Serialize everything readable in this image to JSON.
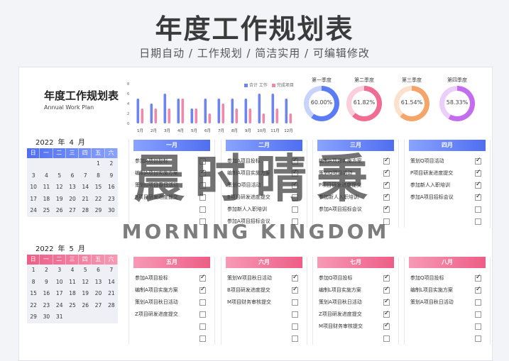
{
  "banner": {
    "title": "年度工作规划表",
    "subtitle": "日期自动 / 工作规划 / 简洁实用 / 可编辑修改"
  },
  "plan": {
    "title": "年度工作规划表",
    "subtitle": "Annual Work Plan"
  },
  "colors": {
    "blue": "#5b7cf5",
    "pink": "#f06c93",
    "orange": "#f5a46a",
    "purple": "#c46cf0"
  },
  "chart_data": {
    "type": "bar",
    "categories": [
      "1月",
      "2月",
      "3月",
      "4月",
      "5月",
      "6月",
      "7月",
      "8月",
      "9月",
      "10月",
      "11月",
      "12月"
    ],
    "series": [
      {
        "name": "合计 工作",
        "color": "#6d86ef",
        "values": [
          5,
          4,
          6,
          5,
          3,
          5,
          5,
          5,
          5,
          6,
          6,
          5
        ]
      },
      {
        "name": "完成项目",
        "color": "#f088aa",
        "values": [
          3,
          3,
          3,
          5,
          3,
          2,
          4,
          3,
          3,
          2,
          3,
          2
        ]
      }
    ],
    "ylim": [
      0,
      8
    ],
    "yticks": [
      "0",
      "2",
      "4",
      "6",
      "8"
    ]
  },
  "quarters": [
    {
      "label": "第一季度",
      "pct": "60.00%",
      "value": 0.6,
      "color": "#5b7cf5"
    },
    {
      "label": "第二季度",
      "pct": "61.82%",
      "value": 0.6182,
      "color": "#f06c93"
    },
    {
      "label": "第三季度",
      "pct": "61.54%",
      "value": 0.6154,
      "color": "#f5a46a"
    },
    {
      "label": "第四季度",
      "pct": "58.33%",
      "value": 0.5833,
      "color": "#c46cf0"
    }
  ],
  "calendars": [
    {
      "year": "2022",
      "month": "4",
      "u_year": "年",
      "u_month": "月",
      "weekdays": [
        "日",
        "一",
        "二",
        "三",
        "四",
        "五",
        "六"
      ],
      "days": [
        "",
        "",
        "",
        "",
        "",
        "1",
        "2",
        "3",
        "4",
        "5",
        "6",
        "7",
        "8",
        "9",
        "10",
        "11",
        "12",
        "13",
        "14",
        "15",
        "16",
        "17",
        "18",
        "19",
        "20",
        "21",
        "22",
        "23",
        "24",
        "25",
        "26",
        "27",
        "28",
        "29",
        "30"
      ]
    },
    {
      "year": "2022",
      "month": "5",
      "u_year": "年",
      "u_month": "月",
      "weekdays": [
        "日",
        "一",
        "二",
        "三",
        "四",
        "五",
        "六"
      ],
      "days": [
        "1",
        "2",
        "3",
        "4",
        "5",
        "6",
        "7",
        "8",
        "9",
        "10",
        "11",
        "12",
        "13",
        "14",
        "15",
        "16",
        "17",
        "18",
        "19",
        "20",
        "21",
        "22",
        "23",
        "24",
        "25",
        "26",
        "27",
        "28",
        "29",
        "30",
        "31"
      ]
    }
  ],
  "months": [
    {
      "name": "一月",
      "tasks": [
        [
          "参加A项目投标",
          false
        ],
        [
          "编制A项目实施方案",
          true
        ],
        [
          "策划U项目春日活动",
          false
        ],
        [
          "R项目研发进度提交",
          false
        ],
        [
          "",
          false
        ],
        [
          "",
          false
        ]
      ]
    },
    {
      "name": "二月",
      "tasks": [
        [
          "参加A项目投标",
          true
        ],
        [
          "编制A项目实施方案",
          true
        ],
        [
          "策划Q项目活动",
          true
        ],
        [
          "B项目研发进度提交",
          false
        ],
        [
          "参加新人入职培训",
          false
        ],
        [
          "参加A项目招标会议",
          false
        ]
      ]
    },
    {
      "name": "三月",
      "tasks": [
        [
          "编制A项目实施方案",
          true
        ],
        [
          "策划Q项目活动",
          true
        ],
        [
          "P项目研发进度提交",
          true
        ],
        [
          "参加新人入职培训",
          true
        ],
        [
          "参加A项目招标会议",
          true
        ],
        [
          "",
          false
        ]
      ]
    },
    {
      "name": "四月",
      "tasks": [
        [
          "策划Q项目活动",
          true
        ],
        [
          "P项目研发进度提交",
          true
        ],
        [
          "参加新人入职培训",
          true
        ],
        [
          "参加A项目招标会议",
          true
        ],
        [
          "",
          false
        ],
        [
          "",
          false
        ]
      ]
    },
    {
      "name": "五月",
      "tasks": [
        [
          "参加A项目投标",
          true
        ],
        [
          "编制A项目实施方案",
          true
        ],
        [
          "策划A项目秋日活动",
          false
        ],
        [
          "Z项目研发进度提交",
          false
        ],
        [
          "",
          false
        ],
        [
          "",
          false
        ]
      ]
    },
    {
      "name": "六月",
      "tasks": [
        [
          "策划W项目秋日活动",
          true
        ],
        [
          "B项目研发进度提交",
          true
        ],
        [
          "M项目财务审核提交",
          false
        ],
        [
          "",
          false
        ],
        [
          "",
          false
        ],
        [
          "",
          false
        ]
      ]
    },
    {
      "name": "七月",
      "tasks": [
        [
          "参加Q项目投标",
          true
        ],
        [
          "编制L项目实施方案",
          true
        ],
        [
          "策划A项目秋日活动",
          true
        ],
        [
          "Z项目研发进度提交",
          true
        ],
        [
          "M项目财务审核提交",
          true
        ],
        [
          "",
          false
        ]
      ]
    },
    {
      "name": "八月",
      "tasks": [
        [
          "参加Q项目投标",
          true
        ],
        [
          "编制L项目实施方案",
          true
        ],
        [
          "策划A项目秋日活动",
          false
        ],
        [
          "",
          false
        ],
        [
          "",
          false
        ],
        [
          "",
          false
        ]
      ]
    }
  ],
  "watermark": {
    "cn": "晨时晴秉",
    "en": "MORNING KINGDOM"
  }
}
